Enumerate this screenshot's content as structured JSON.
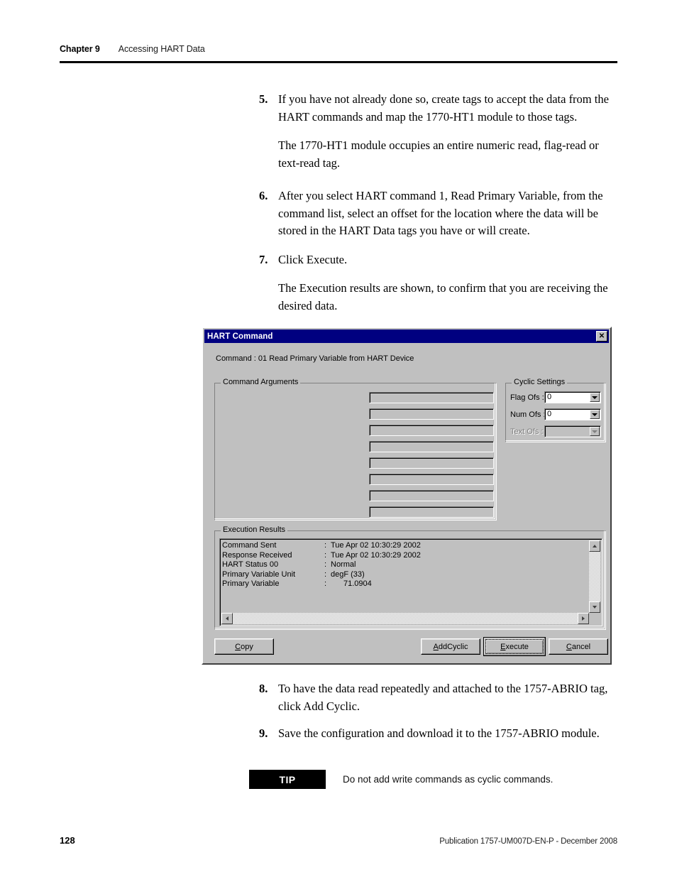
{
  "page": {
    "chapter_label": "Chapter 9",
    "chapter_title": "Accessing HART Data",
    "page_number": "128",
    "publication": "Publication 1757-UM007D-EN-P - December 2008"
  },
  "steps": [
    {
      "number": "5.",
      "text": "If you have not already done so, create tags to accept the data from the HART commands and map the 1770-HT1 module to those tags.",
      "sub": "The 1770-HT1 module occupies an entire numeric read, flag-read or text-read tag."
    },
    {
      "number": "6.",
      "text": "After you select HART command 1, Read Primary Variable, from the command list, select an offset for the location where the data will be stored in the HART Data tags you have or will create.",
      "sub": ""
    },
    {
      "number": "7.",
      "text": "Click Execute.",
      "sub": "The Execution results are shown, to confirm that you are receiving the desired data."
    },
    {
      "number": "8.",
      "text": "To have the data read repeatedly and attached to the 1757-ABRIO tag, click Add Cyclic.",
      "sub": ""
    },
    {
      "number": "9.",
      "text": "Save the configuration and download it to the 1757-ABRIO module.",
      "sub": ""
    }
  ],
  "tip": {
    "badge": "TIP",
    "text": "Do not add write commands as cyclic commands."
  },
  "dialog": {
    "title": "HART Command",
    "close_icon": "✕",
    "command_line": "Command : 01 Read Primary Variable from HART Device",
    "command_arguments": {
      "legend": "Command Arguments",
      "fields": [
        "",
        "",
        "",
        "",
        "",
        "",
        "",
        ""
      ]
    },
    "cyclic_settings": {
      "legend": "Cyclic Settings",
      "rows": [
        {
          "label": "Flag Ofs :",
          "value": "0",
          "enabled": true
        },
        {
          "label": "Num Ofs :",
          "value": "0",
          "enabled": true
        },
        {
          "label": "Text Ofs :",
          "value": "",
          "enabled": false
        }
      ]
    },
    "execution_results": {
      "legend": "Execution Results",
      "rows": [
        {
          "key": "Command Sent",
          "sep": ":",
          "value": "Tue Apr 02 10:30:29 2002"
        },
        {
          "key": "Response Received",
          "sep": ":",
          "value": "Tue Apr 02 10:30:29 2002"
        },
        {
          "key": "HART Status 00",
          "sep": ":",
          "value": "Normal"
        },
        {
          "key": "Primary Variable Unit",
          "sep": ":",
          "value": "degF (33)"
        },
        {
          "key": "Primary Variable",
          "sep": ":",
          "value": "71.0904"
        }
      ]
    },
    "buttons": {
      "copy": {
        "accel": "C",
        "rest": "opy"
      },
      "addcyclic": {
        "accel": "A",
        "rest": "ddCyclic"
      },
      "execute": {
        "accel": "E",
        "rest": "xecute"
      },
      "cancel": {
        "accel": "C",
        "rest": "ancel"
      }
    },
    "colors": {
      "titlebar": "#000080",
      "face": "#c0c0c0",
      "field": "#ffffff"
    }
  }
}
